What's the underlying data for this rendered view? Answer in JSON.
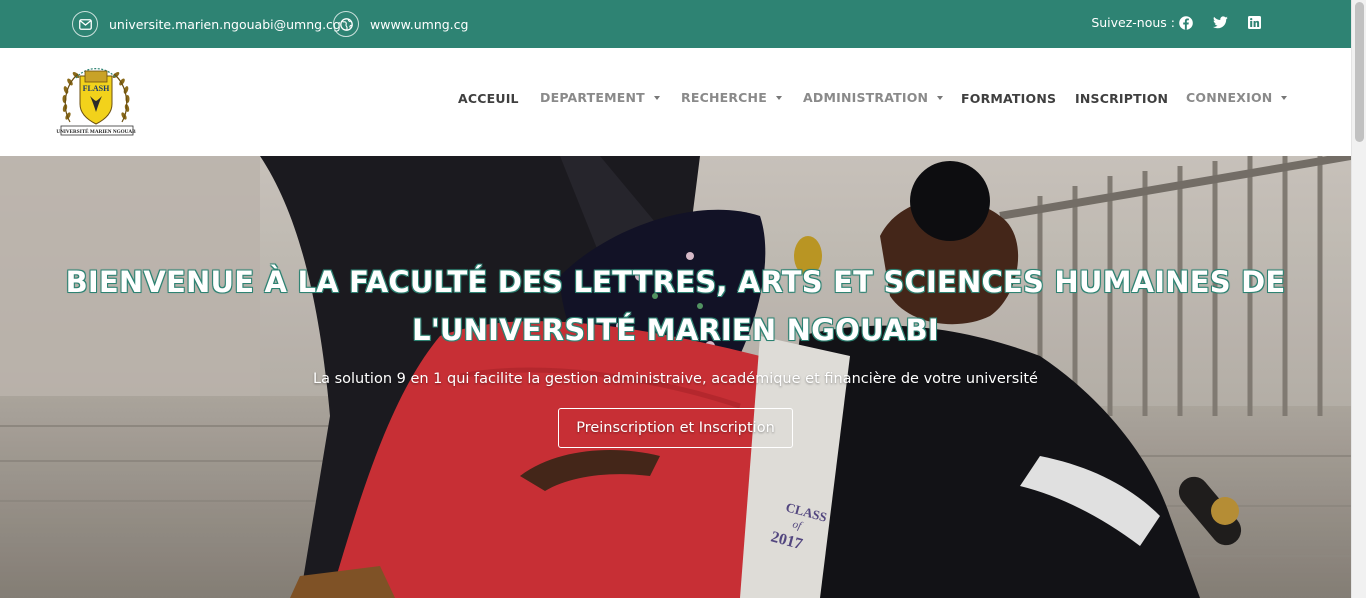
{
  "topbar": {
    "email": "universite.marien.ngouabi@umng.cg",
    "website": "wwww.umng.cg",
    "follow_label": "Suivez-nous :",
    "social": [
      "facebook-icon",
      "twitter-icon",
      "linkedin-icon"
    ],
    "bg_color": "#2e8373"
  },
  "logo": {
    "badge_text": "FLASH",
    "banner_text": "UNIVERSITÉ MARIEN NGOUABI"
  },
  "nav": {
    "items": [
      {
        "label": "ACCEUIL",
        "dropdown": false
      },
      {
        "label": "DEPARTEMENT",
        "dropdown": true
      },
      {
        "label": "RECHERCHE",
        "dropdown": true
      },
      {
        "label": "ADMINISTRATION",
        "dropdown": true
      },
      {
        "label": "FORMATIONS",
        "dropdown": false
      },
      {
        "label": "INSCRIPTION",
        "dropdown": false
      },
      {
        "label": "CONNEXION",
        "dropdown": true
      }
    ]
  },
  "hero": {
    "title_line1": "BIENVENUE À LA FACULTÉ DES LETTRES, ARTS ET SCIENCES HUMAINES DE",
    "title_line2": "L'UNIVERSITÉ MARIEN NGOUABI",
    "subtitle": "La solution 9 en 1 qui facilite la gestion administraive, académique et financière de votre université",
    "button_label": "Preinscription et Inscription",
    "gown_text_1": "CLASS",
    "gown_text_2": "of",
    "gown_text_3": "2017",
    "accent_color": "#2e8373"
  }
}
